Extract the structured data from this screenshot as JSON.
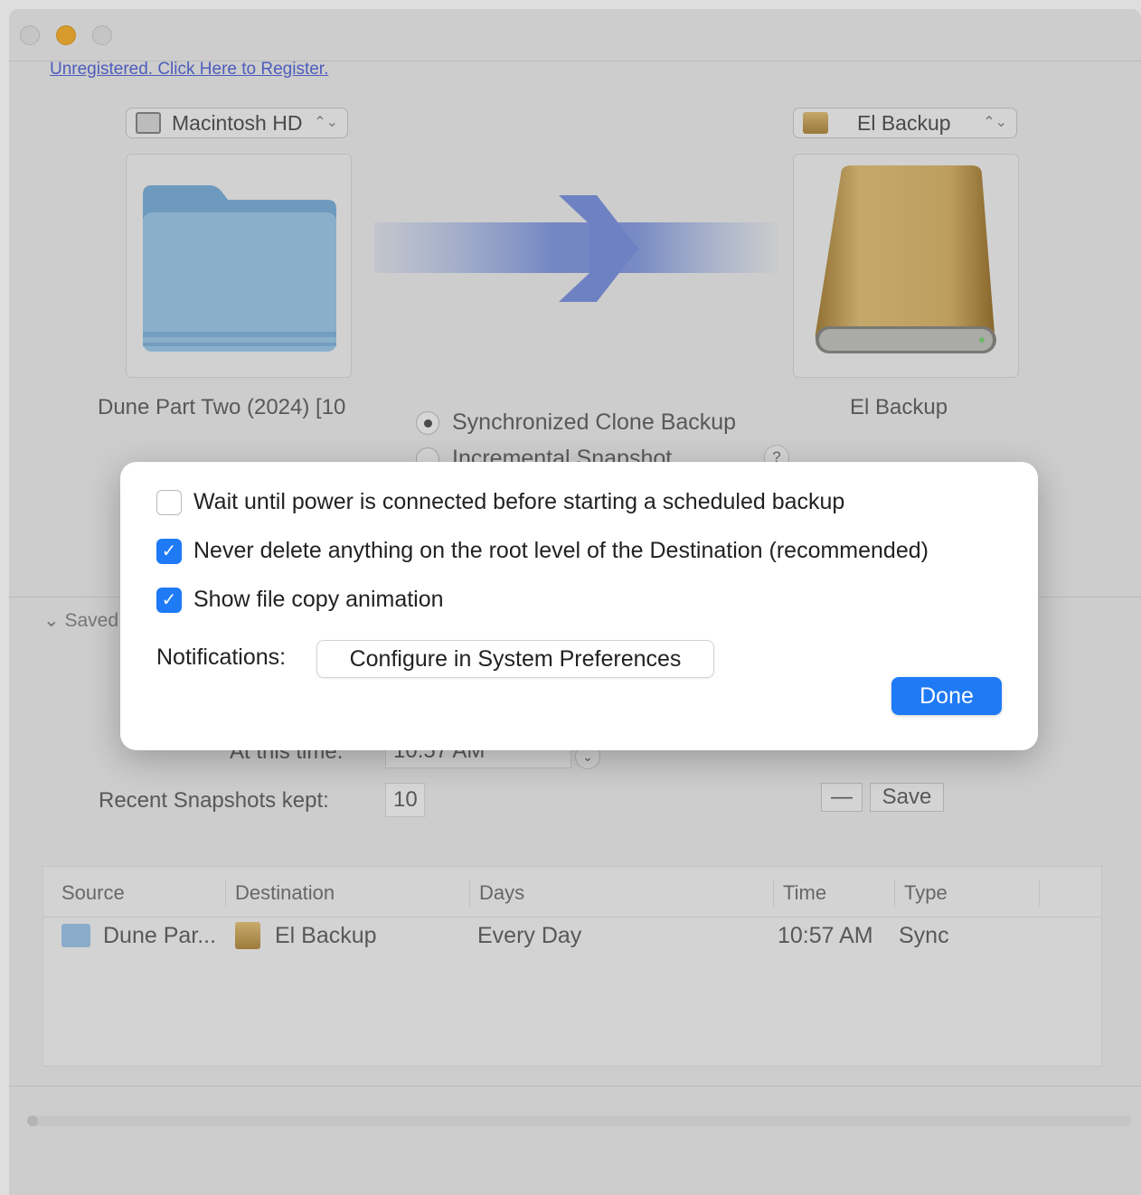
{
  "register_link": "Unregistered. Click Here to Register.",
  "source": {
    "popup_label": "Macintosh HD",
    "caption": "Dune Part Two (2024) [10"
  },
  "destination": {
    "popup_label": "El Backup",
    "caption": "El Backup"
  },
  "mode": {
    "option_sync": "Synchronized Clone Backup",
    "option_incremental": "Incremental Snapshot",
    "help": "?"
  },
  "schedule": {
    "saved_label": "Saved",
    "time_label": "At this time:",
    "time_value": "10:57 AM",
    "snapshots_label": "Recent Snapshots kept:",
    "snapshots_value": "10",
    "minus_label": "—",
    "save_label": "Save"
  },
  "table": {
    "headers": [
      "Source",
      "Destination",
      "Days",
      "Time",
      "Type"
    ],
    "rows": [
      {
        "source": "Dune Par...",
        "destination": "El Backup",
        "days": "Every Day",
        "time": "10:57 AM",
        "type": "Sync"
      }
    ]
  },
  "sheet": {
    "option_power": "Wait until power is connected before starting a scheduled backup",
    "option_never_delete": "Never delete anything on the root level of the Destination (recommended)",
    "option_animation": "Show file copy animation",
    "notifications_label": "Notifications:",
    "configure_button": "Configure in System Preferences",
    "done_button": "Done",
    "checks": {
      "power": false,
      "never_delete": true,
      "animation": true
    }
  },
  "colors": {
    "accent": "#1f7af6",
    "link": "#5a6ad8",
    "drive_gold": "#c9a45c",
    "folder_blue": "#8fbce4"
  }
}
